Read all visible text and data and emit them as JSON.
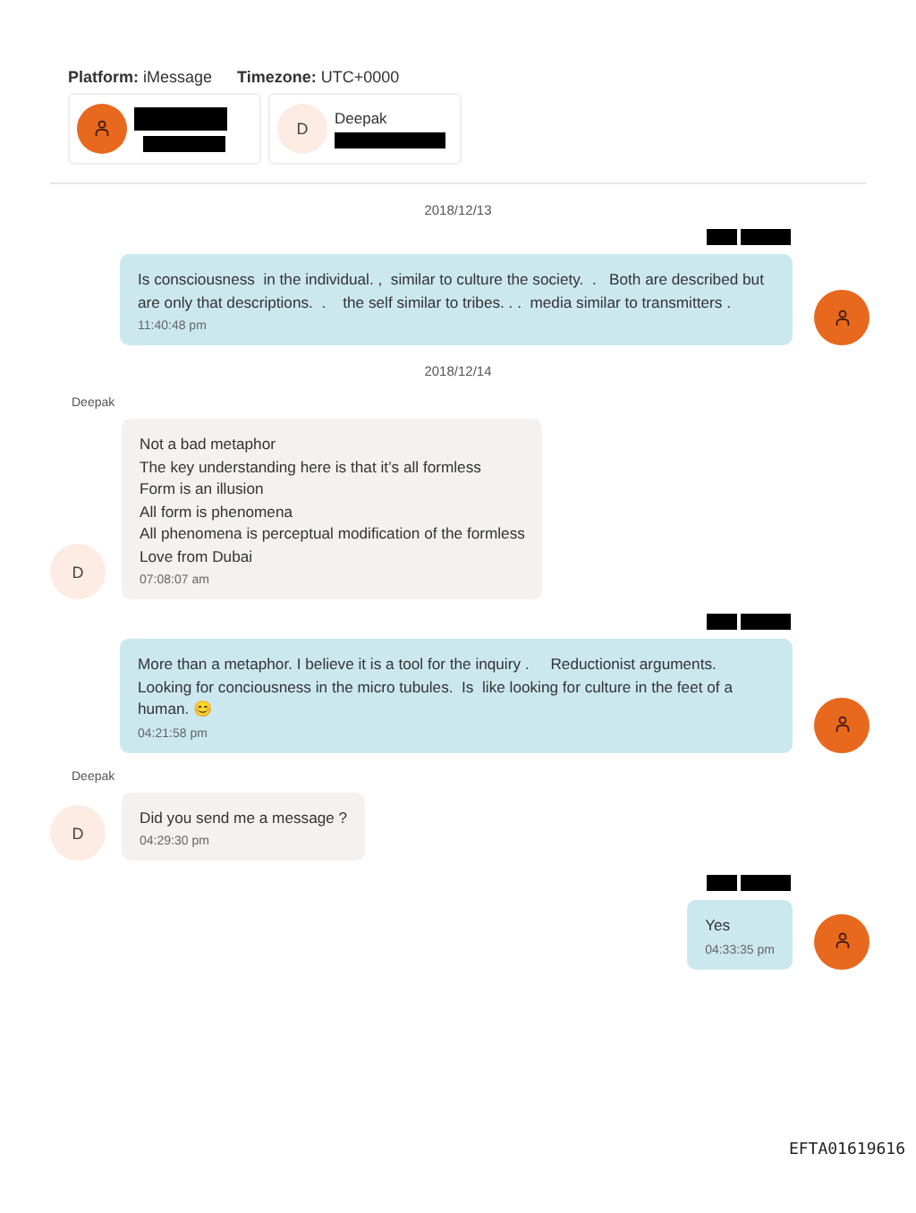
{
  "header": {
    "platform_label": "Platform:",
    "platform": "iMessage",
    "timezone_label": "Timezone:",
    "timezone": "UTC+0000"
  },
  "participants": [
    {
      "kind": "owner"
    },
    {
      "kind": "contact",
      "initial": "D",
      "name": "Deepak"
    }
  ],
  "messages": [
    {
      "kind": "date",
      "text": "2018/12/13"
    },
    {
      "kind": "outgoing",
      "text": "Is consciousness  in the individual. ,  similar to culture the society.  .   Both are described but are only that descriptions.  .    the self similar to tribes. . .  media similar to transmitters .",
      "time": "11:40:48 pm"
    },
    {
      "kind": "date",
      "text": "2018/12/14"
    },
    {
      "kind": "incoming",
      "sender": "Deepak",
      "initial": "D",
      "text": "Not a bad metaphor\nThe key understanding here is that it’s all formless\nForm is an illusion\nAll form is phenomena\nAll phenomena is perceptual modification of the formless\nLove from Dubai",
      "time": "07:08:07 am"
    },
    {
      "kind": "outgoing",
      "text": "More than a metaphor. I believe it is a tool for the inquiry .     Reductionist arguments.  Looking for conciousness in the micro tubules.  Is  like looking for culture in the feet of a human. 😊",
      "time": "04:21:58 pm"
    },
    {
      "kind": "incoming",
      "sender": "Deepak",
      "initial": "D",
      "text": "Did you send me a message ?",
      "time": "04:29:30 pm"
    },
    {
      "kind": "outgoing",
      "text": "Yes",
      "time": "04:33:35 pm"
    }
  ],
  "footer": {
    "doc_id": "EFTA01619616"
  }
}
